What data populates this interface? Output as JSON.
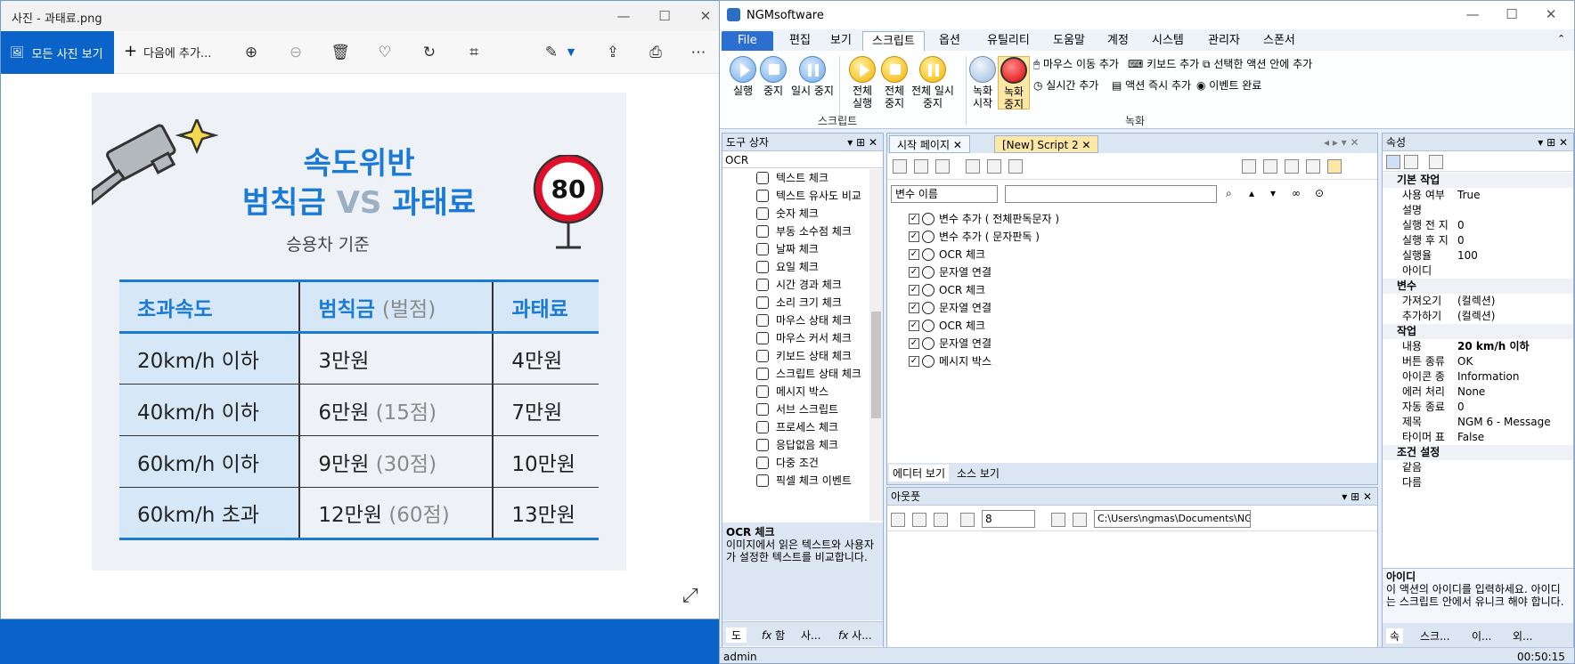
{
  "photos": {
    "title": "사진 - 과태료.png",
    "all_photos": "모든 사진 보기",
    "add_to": "다음에 추가...",
    "image": {
      "title1": "속도위반",
      "title2a": "범칙금",
      "title2b": "VS",
      "title2c": "과태료",
      "subtitle": "승용차 기준",
      "sign": "80",
      "headers": [
        "초과속도",
        "범칙금",
        "(벌점)",
        "과태료"
      ],
      "rows": [
        {
          "speed": "20km/h 이하",
          "fine": "3만원",
          "pts": "",
          "penalty": "4만원"
        },
        {
          "speed": "40km/h 이하",
          "fine": "6만원",
          "pts": "(15점)",
          "penalty": "7만원"
        },
        {
          "speed": "60km/h 이하",
          "fine": "9만원",
          "pts": "(30점)",
          "penalty": "10만원"
        },
        {
          "speed": "60km/h 초과",
          "fine": "12만원",
          "pts": "(60점)",
          "penalty": "13만원"
        }
      ]
    }
  },
  "ngm": {
    "title": "NGMsoftware",
    "menu": [
      "File",
      "편집",
      "보기",
      "스크립트",
      "옵션",
      "유틸리티",
      "도움말",
      "계정",
      "시스템",
      "관리자",
      "스폰서"
    ],
    "ribbon": {
      "buttons": [
        "실행",
        "중지",
        "일시 중지",
        "전체 실행",
        "전체 중지",
        "전체 일시 중지",
        "녹화 시작",
        "녹화 중지"
      ],
      "small": [
        "마우스 이동 추가",
        "키보드 추가",
        "선택한 액션 안에 추가",
        "실시간 추가",
        "액션 즉시 추가",
        "이벤트 완료"
      ],
      "group_script": "스크립트",
      "group_record": "녹화"
    },
    "toolbox": {
      "title": "도구 상자",
      "search": "OCR",
      "items": [
        "텍스트 체크",
        "텍스트 유사도 비교",
        "숫자 체크",
        "부동 소수점 체크",
        "날짜 체크",
        "요일 체크",
        "시간 경과 체크",
        "소리 크기 체크",
        "마우스 상태 체크",
        "마우스 커서 체크",
        "키보드 상태 체크",
        "스크립트 상태 체크",
        "메시지 박스",
        "서브 스크립트",
        "프로세스 체크",
        "응답없음 체크",
        "다중 조건",
        "픽셀 체크 이벤트"
      ],
      "desc_title": "OCR 체크",
      "desc": "이미지에서 읽은 텍스트와 사용자가 설정한 텍스트를 비교합니다.",
      "tabs": [
        "도",
        "함",
        "사...",
        "사..."
      ]
    },
    "doc": {
      "tabs": [
        "시작 페이지",
        "[New] Script 2"
      ],
      "var_placeholder": "변수 이름",
      "lines": [
        "변수 추가 ( 전체판독문자 )",
        "변수 추가 ( 문자판독 )",
        "OCR 체크",
        "문자열 연결",
        "OCR 체크",
        "문자열 연결",
        "OCR 체크",
        "문자열 연결",
        "메시지 박스"
      ],
      "bottom_tabs": [
        "에디터 보기",
        "소스 보기"
      ]
    },
    "output": {
      "title": "아웃풋",
      "size": "8",
      "path": "C:\\Users\\ngmas\\Documents\\NGM6\\"
    },
    "props": {
      "title": "속성",
      "rows": [
        {
          "cat": true,
          "k": "기본 작업"
        },
        {
          "k": "사용 여부",
          "v": "True"
        },
        {
          "k": "설명",
          "v": ""
        },
        {
          "k": "실행 전 지",
          "v": "0"
        },
        {
          "k": "실행 후 지",
          "v": "0"
        },
        {
          "k": "실행율",
          "v": "100"
        },
        {
          "k": "아이디",
          "v": ""
        },
        {
          "cat": true,
          "k": "변수"
        },
        {
          "k": "가져오기",
          "v": "(컬렉션)"
        },
        {
          "k": "추가하기",
          "v": "(컬렉션)"
        },
        {
          "cat": true,
          "k": "작업"
        },
        {
          "k": "내용",
          "v": "20 km/h 이하"
        },
        {
          "k": "버튼 종류",
          "v": "OK"
        },
        {
          "k": "아이콘 종",
          "v": "Information"
        },
        {
          "k": "에러 처리",
          "v": "None"
        },
        {
          "k": "자동 종료",
          "v": "0"
        },
        {
          "k": "제목",
          "v": "NGM 6 - Message"
        },
        {
          "k": "타이머 표",
          "v": "False"
        },
        {
          "cat": true,
          "k": "조건 설정"
        },
        {
          "k": "같음",
          "v": ""
        },
        {
          "k": "다름",
          "v": ""
        }
      ],
      "desc_title": "아이디",
      "desc": "이 액션의 아이디를 입력하세요. 아이디는 스크립트 안에서 유니크 해야 합니다.",
      "tabs": [
        "속",
        "스크...",
        "이...",
        "외..."
      ]
    },
    "status": {
      "user": "admin",
      "time": "00:50:15"
    }
  }
}
